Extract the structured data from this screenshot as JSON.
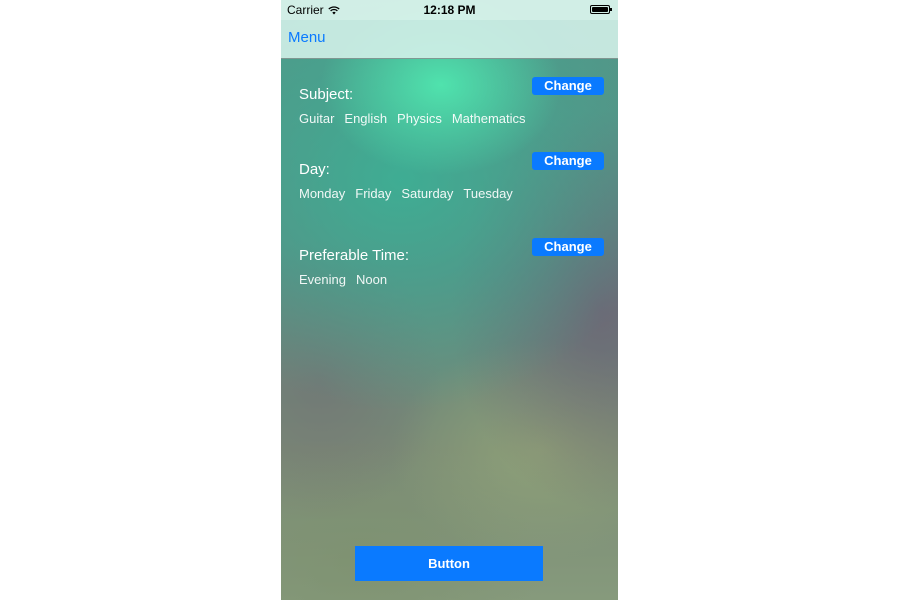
{
  "status_bar": {
    "carrier": "Carrier",
    "time": "12:18 PM",
    "wifi_icon": "wifi-icon",
    "battery_icon": "battery-icon",
    "battery_level": 1.0
  },
  "nav": {
    "menu_label": "Menu"
  },
  "sections": [
    {
      "title": "Subject:",
      "change_label": "Change",
      "items": [
        "Guitar",
        "English",
        "Physics",
        "Mathematics"
      ]
    },
    {
      "title": "Day:",
      "change_label": "Change",
      "items": [
        "Monday",
        "Friday",
        "Saturday",
        "Tuesday"
      ]
    },
    {
      "title": "Preferable Time:",
      "change_label": "Change",
      "items": [
        "Evening",
        "Noon"
      ]
    }
  ],
  "primary_button_label": "Button",
  "colors": {
    "accent": "#0a7aff",
    "text": "#ffffff"
  }
}
